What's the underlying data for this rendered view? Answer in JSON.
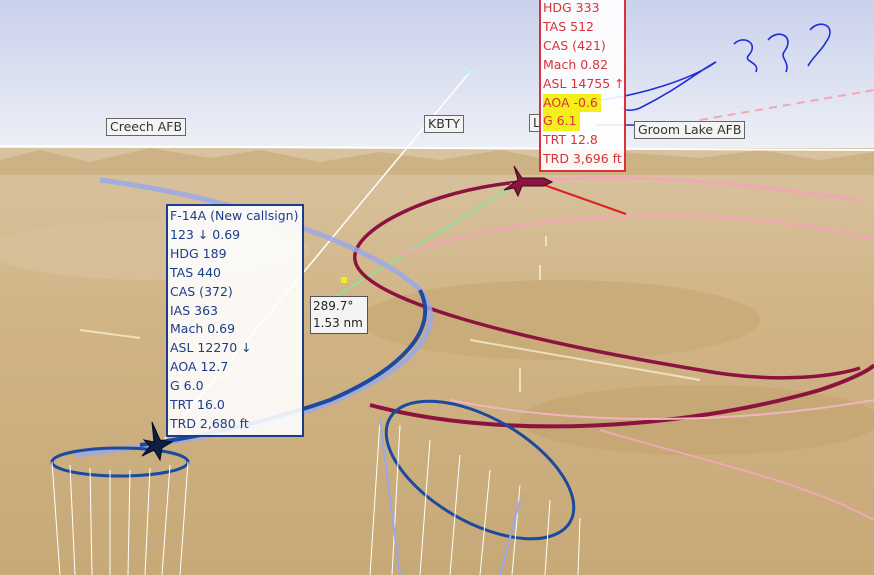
{
  "map_labels": {
    "creech": "Creech AFB",
    "kbty": "KBTY",
    "l_partial": "L",
    "groom": "Groom Lake AFB"
  },
  "blue_panel": {
    "lines": [
      "F-14A (New callsign)",
      "123 ↓ 0.69",
      "HDG 189",
      "TAS 440",
      "CAS (372)",
      "IAS 363",
      "Mach 0.69",
      "ASL 12270 ↓",
      "AOA 12.7",
      "G 6.0",
      "TRT 16.0",
      "TRD 2,680 ft"
    ]
  },
  "red_panel": {
    "lines": [
      "HDG 333",
      "TAS 512",
      "CAS (421)",
      "Mach 0.82",
      "ASL 14755 ↑",
      "AOA -0.6",
      "G 6.1",
      "TRT 12.8",
      "TRD 3,696 ft"
    ]
  },
  "measurement": {
    "bearing": "289.7°",
    "distance": "1.53 nm"
  },
  "annotation": {
    "text": "???"
  },
  "colors": {
    "friendly": "#1b3d8a",
    "hostile": "#d9323a",
    "highlight": "#f2ef1a",
    "sky": "#d9deee",
    "terrain": "#cdb48a"
  }
}
